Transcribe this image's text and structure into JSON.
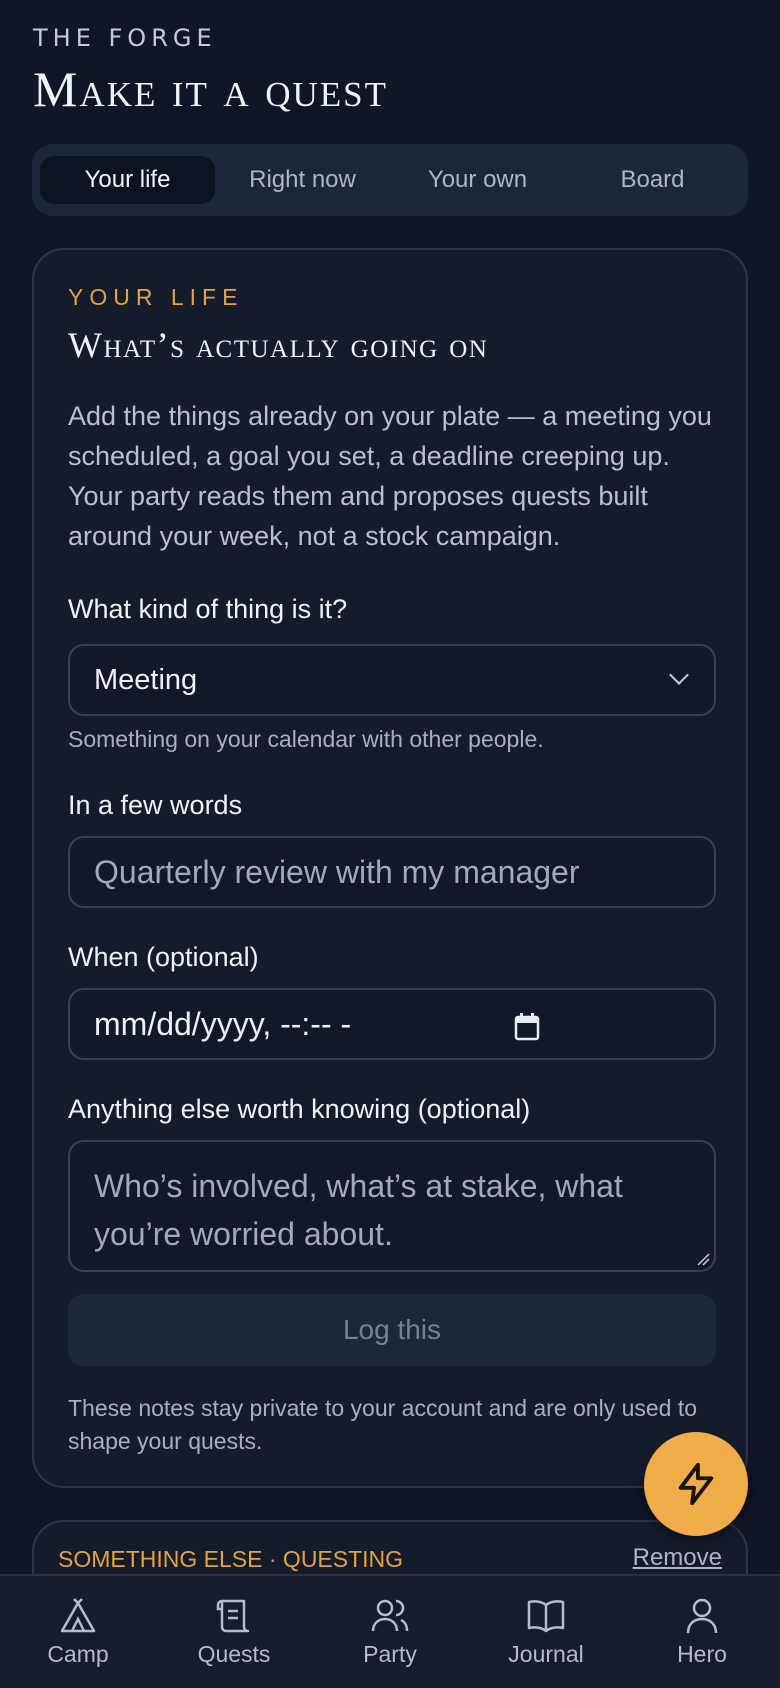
{
  "header": {
    "eyebrow": "THE FORGE",
    "title": "Make it a quest"
  },
  "tabs": [
    {
      "label": "Your life",
      "active": true
    },
    {
      "label": "Right now",
      "active": false
    },
    {
      "label": "Your own",
      "active": false
    },
    {
      "label": "Board",
      "active": false
    }
  ],
  "section": {
    "eyebrow": "YOUR LIFE",
    "title": "What’s actually going on",
    "description": "Add the things already on your plate — a meeting you scheduled, a goal you set, a deadline creeping up. Your party reads them and proposes quests built around your week, not a stock campaign."
  },
  "form": {
    "kind_label": "What kind of thing is it?",
    "kind_value": "Meeting",
    "kind_hint": "Something on your calendar with other people.",
    "words_label": "In a few words",
    "words_placeholder": "Quarterly review with my manager",
    "when_label": "When (optional)",
    "when_placeholder": "mm/dd/yyyy, --:-- -",
    "extra_label": "Anything else worth knowing (optional)",
    "extra_placeholder": "Who’s involved, what’s at stake, what you’re worried about.",
    "submit_label": "Log this",
    "privacy_note": "These notes stay private to your account and are only used to shape your quests."
  },
  "next_card": {
    "eyebrow": "SOMETHING ELSE · QUESTING",
    "remove_label": "Remove"
  },
  "fab": {
    "icon": "lightning-icon",
    "color": "#f0ac48"
  },
  "nav": [
    {
      "label": "Camp",
      "icon": "tent-icon"
    },
    {
      "label": "Quests",
      "icon": "scroll-icon"
    },
    {
      "label": "Party",
      "icon": "users-icon"
    },
    {
      "label": "Journal",
      "icon": "book-icon"
    },
    {
      "label": "Hero",
      "icon": "user-icon"
    }
  ],
  "colors": {
    "background": "#0f1625",
    "accent": "#e5a23d"
  }
}
